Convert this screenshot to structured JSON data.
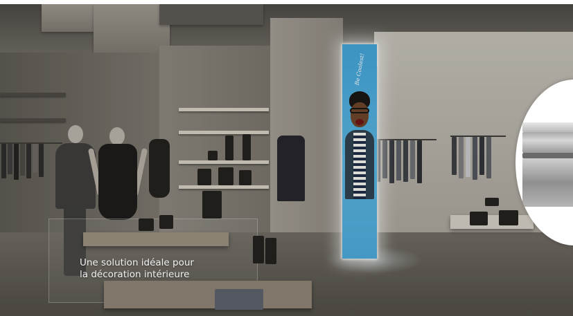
{
  "caption": {
    "line1": "Une solution idéale pour",
    "line2": "la décoration intérieure"
  },
  "poster": {
    "brand_text": "Be Coolest!"
  },
  "colors": {
    "poster_blue": "#4aa8db",
    "caption_text": "#f2f2f2",
    "zoom_bg": "#ffffff"
  }
}
